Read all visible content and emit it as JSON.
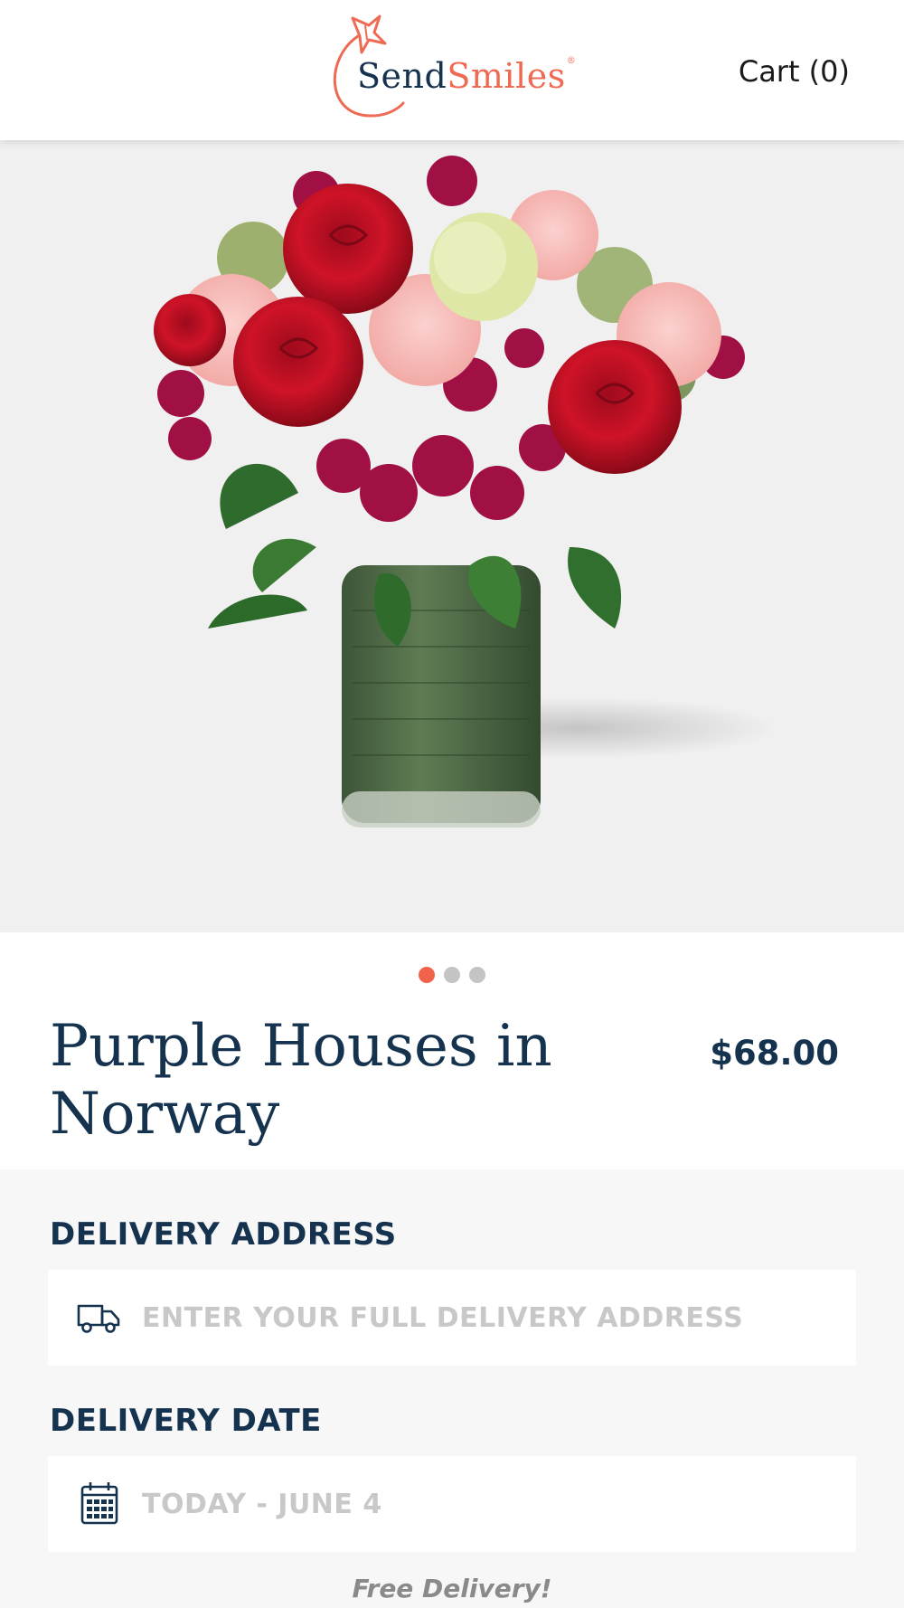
{
  "header": {
    "logo": {
      "send": "Send",
      "smiles": "Smiles",
      "reg": "®"
    },
    "cart_label": "Cart (0)"
  },
  "carousel": {
    "image": "bouquet of red roses, pink carnations and magenta sweet william in a leaf-lined glass vase",
    "slide_count": 3,
    "active_index": 0
  },
  "product": {
    "title": "Purple Houses in Norway",
    "price": "$68.00"
  },
  "delivery": {
    "address_label": "DELIVERY ADDRESS",
    "address_placeholder": "ENTER YOUR FULL DELIVERY ADDRESS",
    "address_icon": "truck-icon",
    "date_label": "DELIVERY DATE",
    "date_placeholder": "TODAY - JUNE 4",
    "date_icon": "calendar-icon",
    "free_note": "Free Delivery!"
  },
  "colors": {
    "navy": "#15324f",
    "accent": "#f06249",
    "placeholder": "#c8c8c8"
  }
}
